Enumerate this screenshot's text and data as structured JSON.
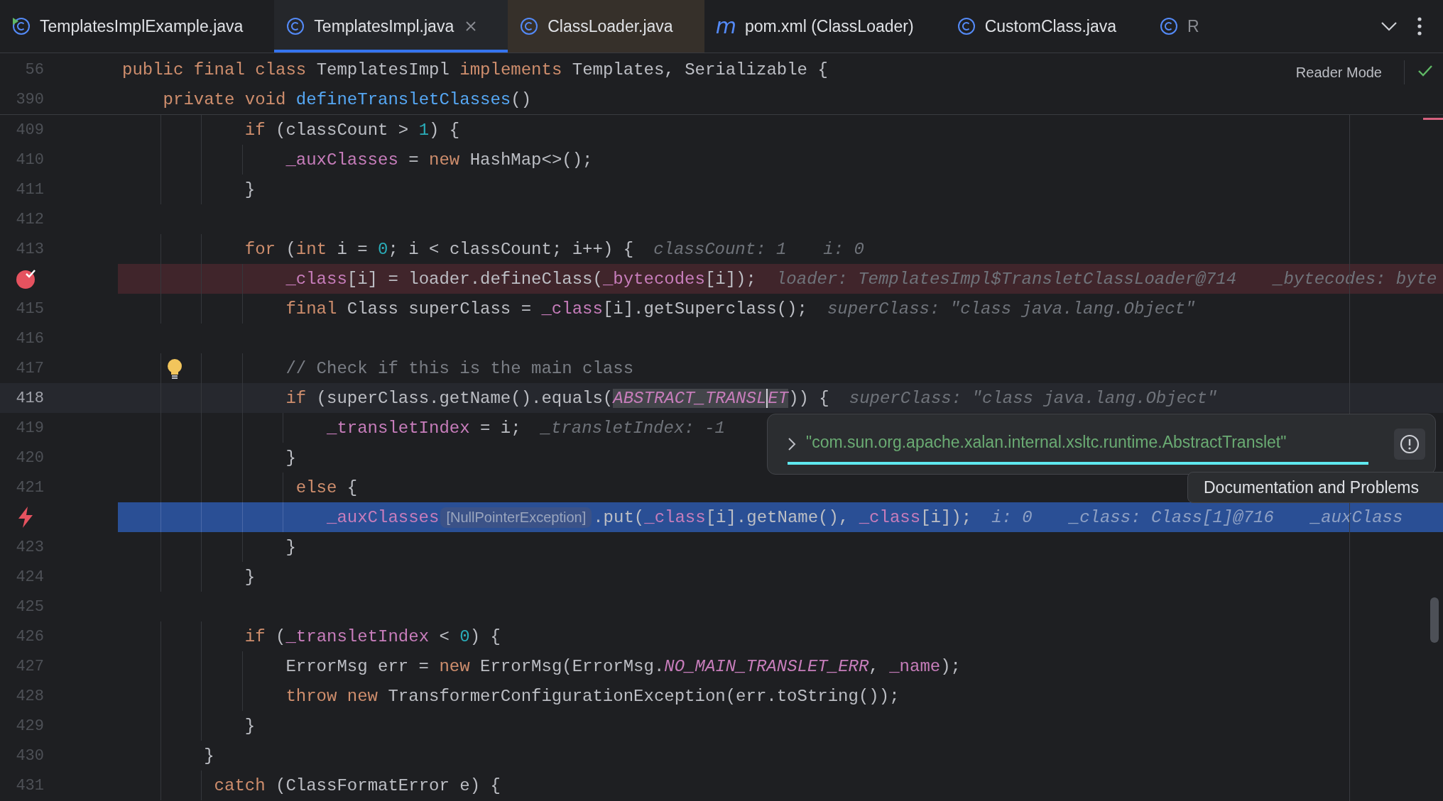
{
  "tabs": [
    {
      "kind": "class",
      "label": "TemplatesImplExample.java",
      "selected": false,
      "runnable": true,
      "closable": false,
      "color": "#1e1f22"
    },
    {
      "kind": "class",
      "label": "TemplatesImpl.java",
      "selected": true,
      "runnable": false,
      "closable": true,
      "color": "#25272b"
    },
    {
      "kind": "class",
      "label": "ClassLoader.java",
      "selected": false,
      "runnable": false,
      "closable": false,
      "color": "#36302a"
    },
    {
      "kind": "maven",
      "icon_text": "m",
      "label": "pom.xml (ClassLoader)",
      "selected": false,
      "runnable": false,
      "closable": false,
      "color": "#1e1f22"
    },
    {
      "kind": "class",
      "label": "CustomClass.java",
      "selected": false,
      "runnable": false,
      "closable": false,
      "color": "#1e1f22"
    },
    {
      "kind": "class",
      "label": "R",
      "selected": false,
      "runnable": false,
      "closable": false,
      "color": "#1e1f22"
    }
  ],
  "sticky_header": {
    "reader_mode": "Reader Mode",
    "lines": [
      {
        "number": "56",
        "tokens": [
          {
            "kind": "keyword",
            "text": "public final class"
          },
          {
            "kind": "plain",
            "text": " TemplatesImpl "
          },
          {
            "kind": "keyword",
            "text": "implements"
          },
          {
            "kind": "plain",
            "text": " Templates, Serializable {"
          }
        ]
      },
      {
        "number": "390",
        "tokens": [
          {
            "kind": "keyword",
            "text": "    private void"
          },
          {
            "kind": "method",
            "text": " defineTransletClasses"
          },
          {
            "kind": "plain",
            "text": "()"
          }
        ]
      }
    ]
  },
  "lines": [
    {
      "kind": "normal",
      "number": "409",
      "segments": [
        {
          "kind": "code",
          "tokens": [
            {
              "kind": "keyword",
              "text": "            if"
            },
            {
              "kind": "plain",
              "text": " (classCount > "
            },
            {
              "kind": "number",
              "text": "1"
            },
            {
              "kind": "plain",
              "text": ") {"
            }
          ]
        }
      ]
    },
    {
      "kind": "normal",
      "number": "410",
      "segments": [
        {
          "kind": "code",
          "tokens": [
            {
              "kind": "field",
              "text": "                _auxClasses"
            },
            {
              "kind": "plain",
              "text": " = "
            },
            {
              "kind": "keyword",
              "text": "new"
            },
            {
              "kind": "plain",
              "text": " HashMap<>();"
            }
          ]
        }
      ]
    },
    {
      "kind": "normal",
      "number": "411",
      "segments": [
        {
          "kind": "code",
          "tokens": [
            {
              "kind": "plain",
              "text": "            }"
            }
          ]
        }
      ]
    },
    {
      "kind": "normal",
      "number": "412"
    },
    {
      "kind": "normal",
      "number": "413",
      "segments": [
        {
          "kind": "code",
          "tokens": [
            {
              "kind": "keyword",
              "text": "            for"
            },
            {
              "kind": "plain",
              "text": " ("
            },
            {
              "kind": "keyword",
              "text": "int"
            },
            {
              "kind": "plain",
              "text": " i = "
            },
            {
              "kind": "number",
              "text": "0"
            },
            {
              "kind": "plain",
              "text": "; i < classCount; i++) {"
            }
          ]
        },
        {
          "kind": "hint",
          "text": "classCount: 1"
        },
        {
          "kind": "hint",
          "text": "i: 0"
        }
      ]
    },
    {
      "kind": "breakpoint",
      "segments": [
        {
          "kind": "code",
          "tokens": [
            {
              "kind": "field",
              "text": "                _class"
            },
            {
              "kind": "plain",
              "text": "[i] = loader.defineClass("
            },
            {
              "kind": "field",
              "text": "_bytecodes"
            },
            {
              "kind": "plain",
              "text": "[i]);"
            }
          ]
        },
        {
          "kind": "hint",
          "text": "loader: TemplatesImpl$TransletClassLoader@714"
        },
        {
          "kind": "hint",
          "text": "_bytecodes: byte"
        }
      ]
    },
    {
      "kind": "normal",
      "number": "415",
      "segments": [
        {
          "kind": "code",
          "tokens": [
            {
              "kind": "keyword",
              "text": "                final"
            },
            {
              "kind": "plain",
              "text": " Class superClass = "
            },
            {
              "kind": "field",
              "text": "_class"
            },
            {
              "kind": "plain",
              "text": "[i].getSuperclass();"
            }
          ]
        },
        {
          "kind": "hint",
          "text": "superClass: \"class java.lang.Object\""
        }
      ]
    },
    {
      "kind": "normal",
      "number": "416"
    },
    {
      "kind": "normal",
      "number": "417",
      "intention": true,
      "segments": [
        {
          "kind": "code",
          "tokens": [
            {
              "kind": "comment",
              "text": "                // Check if this is the main class"
            }
          ]
        }
      ]
    },
    {
      "kind": "caret",
      "number": "418",
      "segments": [
        {
          "kind": "code",
          "tokens": [
            {
              "kind": "keyword",
              "text": "                if"
            },
            {
              "kind": "plain",
              "text": " (superClass.getName().equals("
            },
            {
              "kind": "constant",
              "text": "ABSTRACT_TRANSL",
              "highlighted": true,
              "caret": false
            },
            {
              "kind": "constant",
              "text": "ET",
              "highlighted": true,
              "caret": true
            },
            {
              "kind": "plain",
              "text": ")) {"
            }
          ]
        },
        {
          "kind": "hint",
          "text": "superClass: \"class java.lang.Object\""
        }
      ]
    },
    {
      "kind": "normal",
      "number": "419",
      "segments": [
        {
          "kind": "code",
          "tokens": [
            {
              "kind": "field",
              "text": "                    _transletIndex"
            },
            {
              "kind": "plain",
              "text": " = i;"
            }
          ]
        },
        {
          "kind": "hint",
          "text": "_transletIndex: -1"
        }
      ]
    },
    {
      "kind": "normal",
      "number": "420",
      "segments": [
        {
          "kind": "code",
          "tokens": [
            {
              "kind": "plain",
              "text": "                }"
            }
          ]
        }
      ]
    },
    {
      "kind": "normal",
      "number": "421",
      "segments": [
        {
          "kind": "code",
          "tokens": [
            {
              "kind": "keyword",
              "text": "                 else"
            },
            {
              "kind": "plain",
              "text": " {"
            }
          ]
        }
      ]
    },
    {
      "kind": "execution",
      "segments": [
        {
          "kind": "code",
          "tokens": [
            {
              "kind": "field",
              "text": "                    _auxClasses"
            }
          ]
        },
        {
          "kind": "badge",
          "text": "[NullPointerException]"
        },
        {
          "kind": "code",
          "tokens": [
            {
              "kind": "plain",
              "text": ".put("
            },
            {
              "kind": "field",
              "text": "_class"
            },
            {
              "kind": "plain",
              "text": "[i].getName(), "
            },
            {
              "kind": "field",
              "text": "_class"
            },
            {
              "kind": "plain",
              "text": "[i]);"
            }
          ]
        },
        {
          "kind": "hint",
          "text": "i: 0"
        },
        {
          "kind": "hint",
          "text": "_class: Class[1]@716"
        },
        {
          "kind": "hint",
          "text": "_auxClass"
        }
      ]
    },
    {
      "kind": "normal",
      "number": "423",
      "segments": [
        {
          "kind": "code",
          "tokens": [
            {
              "kind": "plain",
              "text": "                }"
            }
          ]
        }
      ]
    },
    {
      "kind": "normal",
      "number": "424",
      "segments": [
        {
          "kind": "code",
          "tokens": [
            {
              "kind": "plain",
              "text": "            }"
            }
          ]
        }
      ]
    },
    {
      "kind": "normal",
      "number": "425"
    },
    {
      "kind": "normal",
      "number": "426",
      "segments": [
        {
          "kind": "code",
          "tokens": [
            {
              "kind": "keyword",
              "text": "            if"
            },
            {
              "kind": "plain",
              "text": " ("
            },
            {
              "kind": "field",
              "text": "_transletIndex"
            },
            {
              "kind": "plain",
              "text": " < "
            },
            {
              "kind": "number",
              "text": "0"
            },
            {
              "kind": "plain",
              "text": ") {"
            }
          ]
        }
      ]
    },
    {
      "kind": "normal",
      "number": "427",
      "segments": [
        {
          "kind": "code",
          "tokens": [
            {
              "kind": "plain",
              "text": "                ErrorMsg err = "
            },
            {
              "kind": "keyword",
              "text": "new"
            },
            {
              "kind": "plain",
              "text": " ErrorMsg(ErrorMsg."
            },
            {
              "kind": "constant",
              "text": "NO_MAIN_TRANSLET_ERR"
            },
            {
              "kind": "plain",
              "text": ", "
            },
            {
              "kind": "field",
              "text": "_name"
            },
            {
              "kind": "plain",
              "text": ");"
            }
          ]
        }
      ]
    },
    {
      "kind": "normal",
      "number": "428",
      "segments": [
        {
          "kind": "code",
          "tokens": [
            {
              "kind": "keyword",
              "text": "                throw new"
            },
            {
              "kind": "plain",
              "text": " TransformerConfigurationException(err.toString());"
            }
          ]
        }
      ]
    },
    {
      "kind": "normal",
      "number": "429",
      "segments": [
        {
          "kind": "code",
          "tokens": [
            {
              "kind": "plain",
              "text": "            }"
            }
          ]
        }
      ]
    },
    {
      "kind": "normal",
      "number": "430",
      "segments": [
        {
          "kind": "code",
          "tokens": [
            {
              "kind": "plain",
              "text": "        }"
            }
          ]
        }
      ]
    },
    {
      "kind": "normal",
      "number": "431",
      "segments": [
        {
          "kind": "code",
          "tokens": [
            {
              "kind": "keyword",
              "text": "         catch"
            },
            {
              "kind": "plain",
              "text": " (ClassFormatError e) {"
            }
          ]
        }
      ]
    }
  ],
  "value_popup": {
    "value": "\"com.sun.org.apache.xalan.internal.xsltc.runtime.AbstractTranslet\""
  },
  "tooltip": {
    "text": "Documentation and Problems"
  }
}
